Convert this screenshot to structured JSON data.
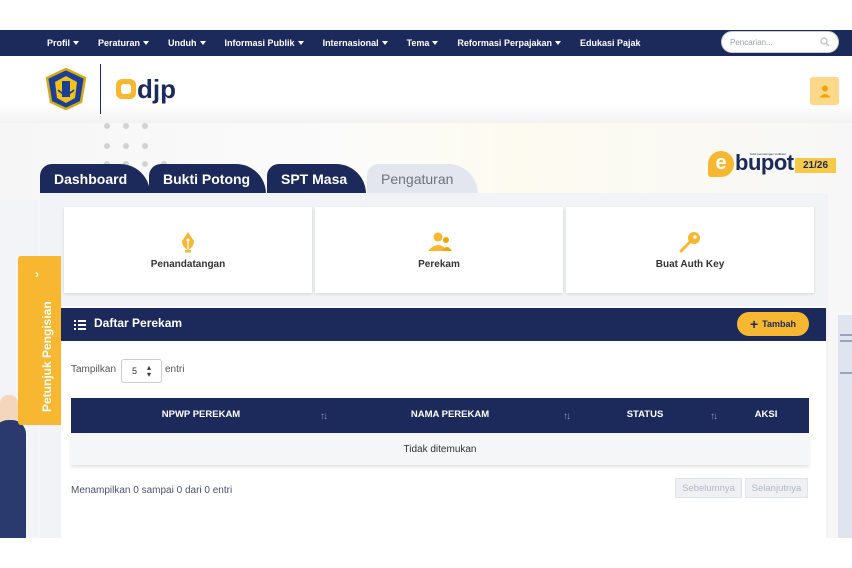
{
  "nav": {
    "items": [
      {
        "label": "Profil",
        "has_caret": true
      },
      {
        "label": "Peraturan",
        "has_caret": true
      },
      {
        "label": "Unduh",
        "has_caret": true
      },
      {
        "label": "Informasi Publik",
        "has_caret": true
      },
      {
        "label": "Internasional",
        "has_caret": true
      },
      {
        "label": "Tema",
        "has_caret": true
      },
      {
        "label": "Reformasi Perpajakan",
        "has_caret": true
      },
      {
        "label": "Edukasi Pajak",
        "has_caret": false
      }
    ],
    "search_placeholder": "Pencarian..."
  },
  "header": {
    "logo_text": "djp",
    "user_icon": "user-icon"
  },
  "app": {
    "brand_e": "e",
    "brand_word": "bupot",
    "brand_tagline": "bukti pemotongan unifikasi",
    "version": "21/26"
  },
  "tabs": [
    {
      "label": "Dashboard",
      "active": false
    },
    {
      "label": "Bukti Potong",
      "active": false
    },
    {
      "label": "SPT Masa",
      "active": false
    },
    {
      "label": "Pengaturan",
      "active": true
    }
  ],
  "settings_cards": [
    {
      "label": "Penandatangan",
      "icon": "pen-nib-icon"
    },
    {
      "label": "Perekam",
      "icon": "users-icon"
    },
    {
      "label": "Buat Auth Key",
      "icon": "key-icon"
    }
  ],
  "list": {
    "title": "Daftar Perekam",
    "add_label": "Tambah",
    "length_prefix": "Tampilkan",
    "length_value": "5",
    "length_suffix": "entri",
    "columns": [
      "NPWP PEREKAM",
      "NAMA PEREKAM",
      "STATUS",
      "AKSI"
    ],
    "empty_text": "Tidak ditemukan",
    "info": "Menampilkan 0 sampai 0 dari 0 entri",
    "prev_label": "Sebelumnya",
    "next_label": "Selanjutnya"
  },
  "guide": {
    "label": "Petunjuk Pengisian",
    "chevron": "›"
  },
  "colors": {
    "navy": "#1c2a5b",
    "accent": "#f7b731",
    "panel": "#f2f3f6"
  }
}
